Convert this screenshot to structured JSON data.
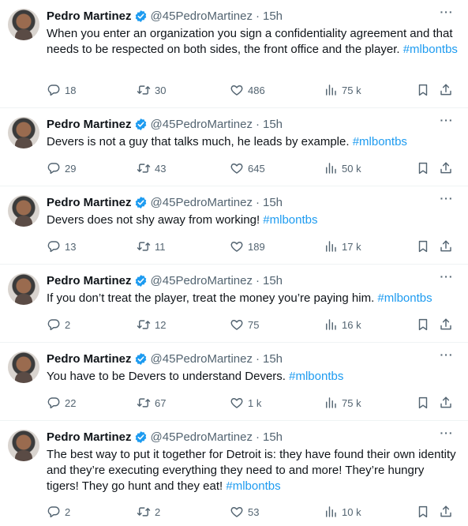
{
  "accent": "#1d9bf0",
  "tweets": [
    {
      "name": "Pedro Martinez",
      "handle": "@45PedroMartinez",
      "time": "15h",
      "text": "When you enter an organization you sign a confidentiality agreement and that needs to be respected on both sides, the front office and the player.",
      "hashtag": "#mlbontbs",
      "replies": "18",
      "retweets": "30",
      "likes": "486",
      "views": "75 k"
    },
    {
      "name": "Pedro Martinez",
      "handle": "@45PedroMartinez",
      "time": "15h",
      "text": "Devers is not a guy that talks much, he leads by example.",
      "hashtag": "#mlbontbs",
      "replies": "29",
      "retweets": "43",
      "likes": "645",
      "views": "50 k"
    },
    {
      "name": "Pedro Martinez",
      "handle": "@45PedroMartinez",
      "time": "15h",
      "text": "Devers does not shy away from working! ",
      "hashtag": "#mlbontbs",
      "replies": "13",
      "retweets": "11",
      "likes": "189",
      "views": "17 k"
    },
    {
      "name": "Pedro Martinez",
      "handle": "@45PedroMartinez",
      "time": "15h",
      "text": "If you don’t treat the player, treat the money you’re paying him.",
      "hashtag": "#mlbontbs",
      "replies": "2",
      "retweets": "12",
      "likes": "75",
      "views": "16 k"
    },
    {
      "name": "Pedro Martinez",
      "handle": "@45PedroMartinez",
      "time": "15h",
      "text": "You have to be Devers to understand Devers.",
      "hashtag": "#mlbontbs",
      "replies": "22",
      "retweets": "67",
      "likes": "1 k",
      "views": "75 k"
    },
    {
      "name": "Pedro Martinez",
      "handle": "@45PedroMartinez",
      "time": "15h",
      "text": "The best way to put it together for Detroit is: they have found their own identity and they’re executing everything they need to and more! They’re hungry tigers! They go hunt and they eat!",
      "hashtag": "#mlbontbs",
      "replies": "2",
      "retweets": "2",
      "likes": "53",
      "views": "10 k"
    }
  ]
}
